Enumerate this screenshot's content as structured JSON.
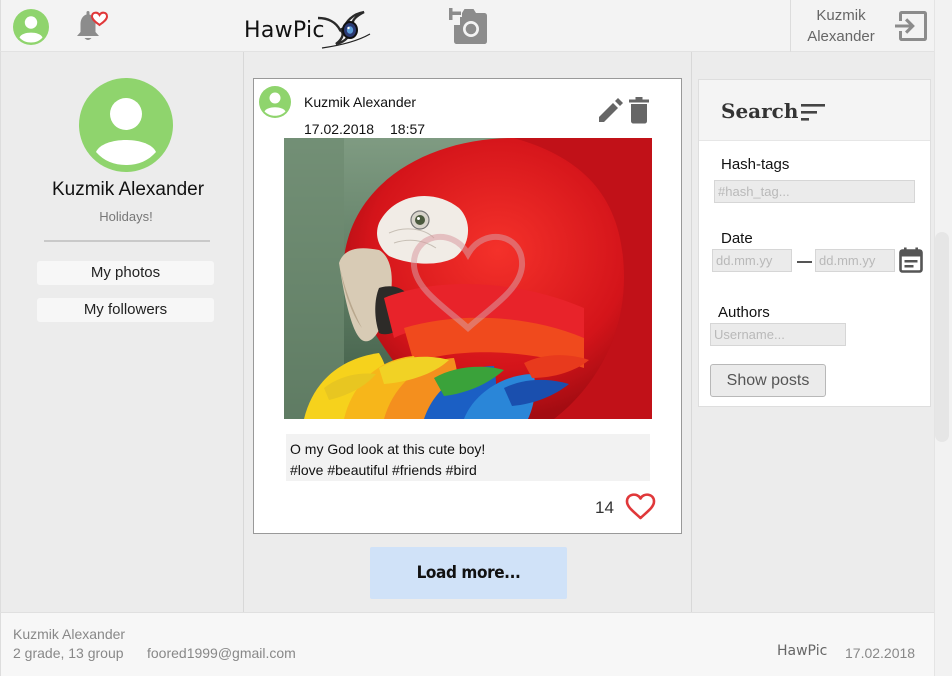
{
  "header": {
    "logo_text": "HawPic",
    "user_name_line1": "Kuzmik",
    "user_name_line2": "Alexander",
    "icons": [
      "avatar-icon",
      "bell-heart-icon",
      "add-photo-icon",
      "logout-icon"
    ]
  },
  "profile": {
    "name": "Kuzmik Alexander",
    "status": "Holidays!",
    "buttons": [
      {
        "label": "My photos"
      },
      {
        "label": "My followers"
      }
    ]
  },
  "post": {
    "author": "Kuzmik Alexander",
    "date": "17.02.2018",
    "time": "18:57",
    "caption_line1": "O my God look at this cute boy!",
    "caption_line2": "#love #beautiful #friends #bird",
    "likes": "14"
  },
  "load_more_label": "Load more...",
  "search": {
    "title": "Search",
    "hashtags_label": "Hash-tags",
    "hashtags_placeholder": "#hash_tag...",
    "date_label": "Date",
    "date_from_placeholder": "dd.mm.yy",
    "date_to_placeholder": "dd.mm.yy",
    "authors_label": "Authors",
    "authors_placeholder": "Username...",
    "submit_label": "Show posts"
  },
  "footer": {
    "name": "Kuzmik Alexander",
    "group": "2 grade, 13 group",
    "email": "foored1999@gmail.com",
    "brand": "HawPic",
    "date": "17.02.2018"
  },
  "colors": {
    "avatar_green": "#8fd46d",
    "like_red": "#e0383a",
    "load_more_bg": "#d0e2f8",
    "panel_gray": "#ececec"
  }
}
